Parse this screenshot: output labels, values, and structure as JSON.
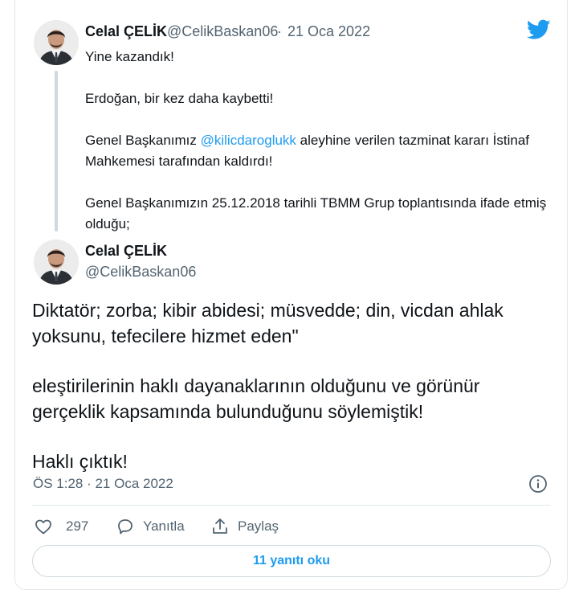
{
  "quoted_tweet": {
    "author_name": "Celal ÇELİK",
    "author_handle": "@CelikBaskan06",
    "separator": "·",
    "date": "21 Oca 2022",
    "line1": "Yine kazandık!",
    "line2": "Erdoğan, bir kez daha kaybetti!",
    "line3_pre": "Genel Başkanımız ",
    "line3_mention": "@kilicdaroglukk",
    "line3_post": " aleyhine verilen tazminat kararı İstinaf Mahkemesi tarafından kaldırdı!",
    "line4": "Genel Başkanımızın 25.12.2018 tarihli TBMM Grup toplantısında ifade etmiş olduğu;"
  },
  "main_tweet": {
    "author_name": "Celal ÇELİK",
    "author_handle": "@CelikBaskan06",
    "paragraph1": "Diktatör; zorba; kibir abidesi; müsvedde; din, vicdan ahlak yoksunu, tefecilere hizmet eden\"",
    "paragraph2": "eleştirilerinin haklı dayanaklarının olduğunu ve görünür gerçeklik kapsamında bulunduğunu söylemiştik!",
    "paragraph3": "Haklı çıktık!",
    "timestamp": "ÖS 1:28 · 21 Oca 2022"
  },
  "actions": {
    "like_count": "297",
    "reply_label": "Yanıtla",
    "share_label": "Paylaş"
  },
  "read_replies_label": "11 yanıtı oku",
  "colors": {
    "accent": "#1d9bf0",
    "text_primary": "#0f1419",
    "text_secondary": "#536471",
    "border": "#e1e8ed"
  },
  "icons": {
    "brand": "twitter-bird-icon",
    "info": "info-icon",
    "like": "heart-icon",
    "reply": "speech-bubble-icon",
    "share": "share-upload-icon"
  }
}
